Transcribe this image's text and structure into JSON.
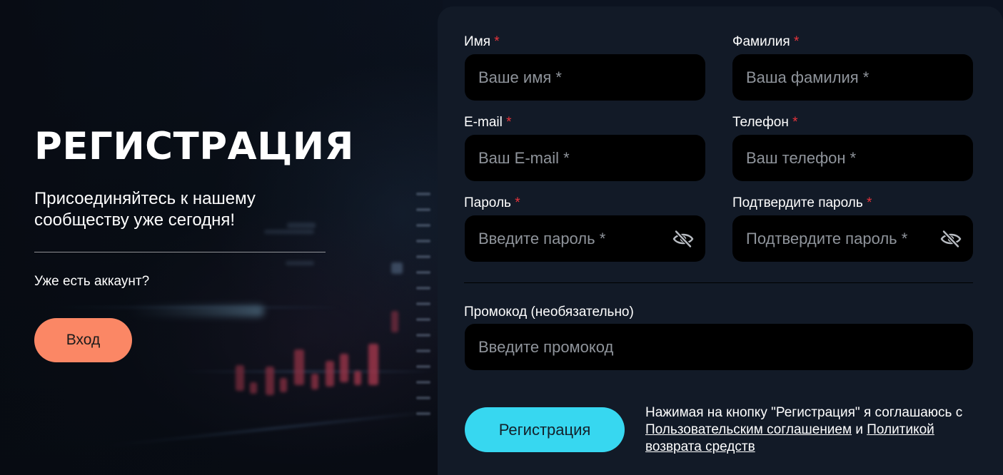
{
  "left": {
    "title": "РЕГИСТРАЦИЯ",
    "subtitle": "Присоединяйтесь к нашему сообществу уже сегодня!",
    "have_account": "Уже есть аккаунт?",
    "login_label": "Вход"
  },
  "form": {
    "first_name": {
      "label": "Имя",
      "placeholder": "Ваше имя *"
    },
    "last_name": {
      "label": "Фамилия",
      "placeholder": "Ваша фамилия *"
    },
    "email": {
      "label": "E-mail",
      "placeholder": "Ваш E-mail *"
    },
    "phone": {
      "label": "Телефон",
      "placeholder": "Ваш телефон *"
    },
    "password": {
      "label": "Пароль",
      "placeholder": "Введите пароль *"
    },
    "confirm_password": {
      "label": "Подтвердите пароль",
      "placeholder": "Подтвердите пароль *"
    },
    "promo": {
      "label": "Промокод (необязательно)",
      "placeholder": "Введите промокод"
    },
    "required_mark": "*",
    "register_label": "Регистрация",
    "agree": {
      "prefix": "Нажимая на кнопку \"Регистрация\" я соглашаюсь с",
      "terms_link": "Пользовательским соглашением",
      "and": "и",
      "refund_link": "Политикой возврата средств"
    }
  },
  "colors": {
    "accent_login": "#fb8765",
    "accent_register": "#37d7f0",
    "required": "#e8343c",
    "panel": "#121a27"
  },
  "icons": {
    "password_toggle": "eye-slash-icon"
  }
}
